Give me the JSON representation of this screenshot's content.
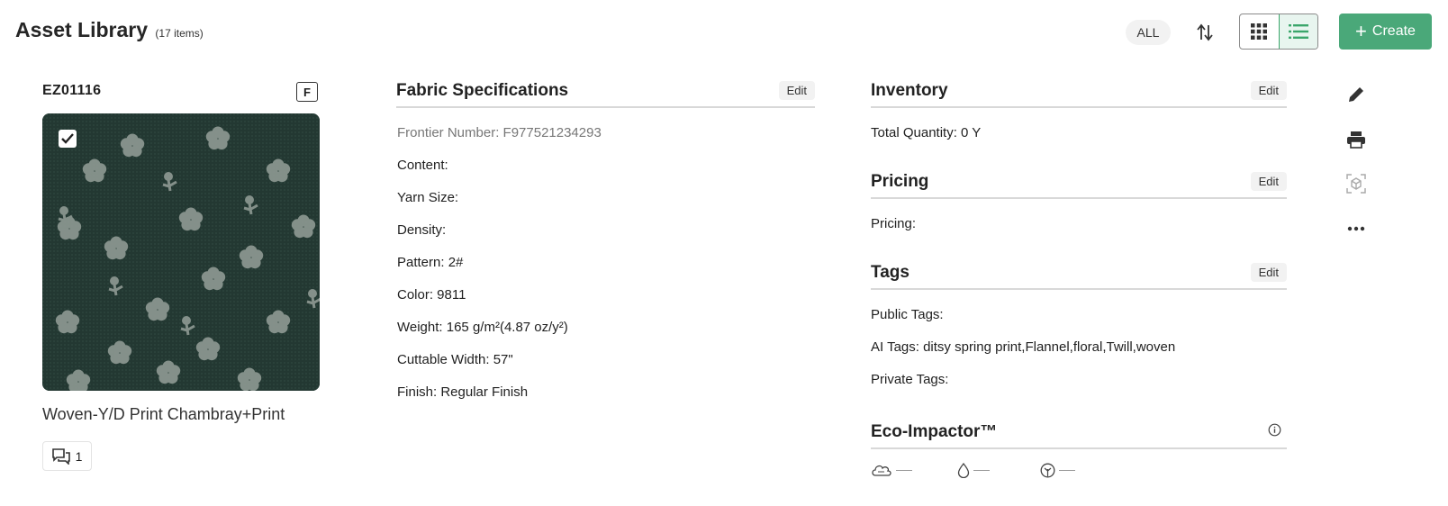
{
  "header": {
    "title": "Asset Library",
    "count": "(17 items)",
    "filter_label": "ALL",
    "create_label": "Create"
  },
  "asset": {
    "code": "EZ01116",
    "badge": "F",
    "name": "Woven-Y/D Print Chambray+Print",
    "comment_count": "1",
    "selected": true
  },
  "fabric_specs": {
    "title": "Fabric Specifications",
    "edit_label": "Edit",
    "fields": [
      "Frontier Number: F977521234293",
      "Content:",
      "Yarn Size:",
      "Density:",
      "Pattern: 2#",
      "Color: 9811",
      "Weight: 165 g/m²(4.87 oz/y²)",
      "Cuttable Width: 57\"",
      "Finish: Regular Finish"
    ]
  },
  "inventory": {
    "title": "Inventory",
    "edit_label": "Edit",
    "total": "Total Quantity: 0 Y"
  },
  "pricing": {
    "title": "Pricing",
    "edit_label": "Edit",
    "value": "Pricing:"
  },
  "tags": {
    "title": "Tags",
    "edit_label": "Edit",
    "public": "Public Tags:",
    "ai": "AI Tags: ditsy spring print,Flannel,floral,Twill,woven",
    "private": "Private Tags:"
  },
  "eco": {
    "title": "Eco-Impactor™",
    "metrics": [
      "co2-cloud-icon",
      "water-drop-icon",
      "land-leaf-icon"
    ]
  },
  "colors": {
    "accent": "#4aa879",
    "fabric_bg": "#243a33",
    "flower": "#8a958f"
  }
}
